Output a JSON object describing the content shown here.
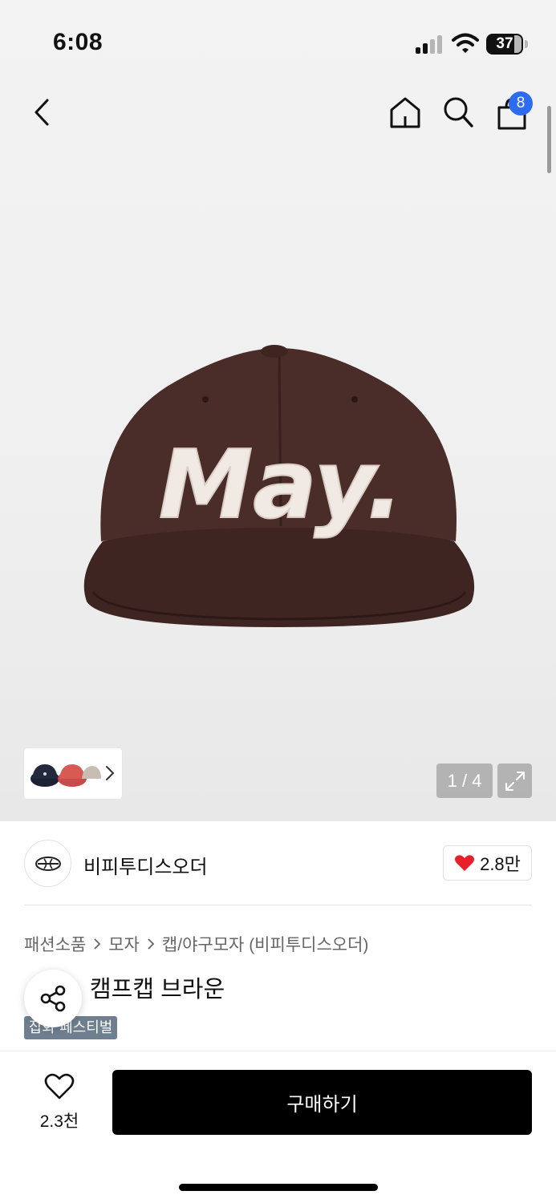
{
  "status_bar": {
    "time": "6:08",
    "battery": "37"
  },
  "header": {
    "cart_count": "8"
  },
  "gallery": {
    "counter": "1 / 4"
  },
  "brand": {
    "name": "비피투디스오더",
    "likes": "2.8만"
  },
  "breadcrumb": {
    "items": [
      "패션소품",
      "모자",
      "캡/야구모자 (비피투디스오더)"
    ]
  },
  "product": {
    "title": "캠프캡 브라운",
    "tag": "잡화 페스티벌",
    "cap_text": "May."
  },
  "bottom_bar": {
    "wish_count": "2.3천",
    "buy_label": "구매하기"
  },
  "colors": {
    "accent_badge": "#2d6bf0",
    "heart": "#e8202a",
    "buy_button": "#000000",
    "tag_bg": "#6f7f8f",
    "cap_brown": "#4a2c28"
  },
  "icons": [
    "back-icon",
    "home-icon",
    "search-icon",
    "shopping-bag-icon",
    "chevron-right-icon",
    "expand-icon",
    "heart-icon",
    "share-icon"
  ]
}
